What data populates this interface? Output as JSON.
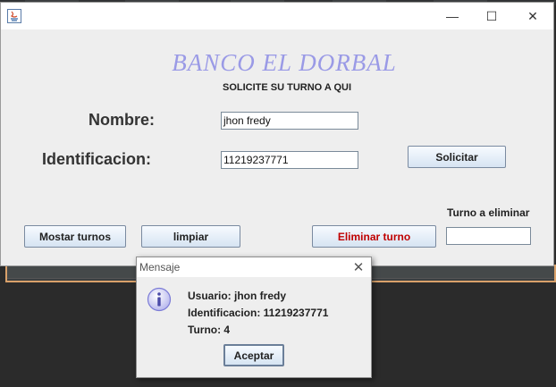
{
  "window": {
    "bank_title": "BANCO EL DORBAL",
    "subtitle": "SOLICITE SU TURNO  A QUI",
    "controls": {
      "minimize": "—",
      "maximize": "☐",
      "close": "✕"
    }
  },
  "form": {
    "nombre_label": "Nombre:",
    "nombre_value": "jhon fredy",
    "identificacion_label": "Identificacion:",
    "identificacion_value": "11219237771",
    "solicitar_button": "Solicitar",
    "turno_eliminar_label": "Turno a eliminar",
    "turno_eliminar_value": ""
  },
  "actions": {
    "mostrar_button": "Mostar turnos",
    "limpiar_button": "limpiar",
    "eliminar_button": "Eliminar turno"
  },
  "dialog": {
    "title": "Mensaje",
    "close": "✕",
    "lines": [
      "Usuario: jhon fredy",
      "Identificacion: 11219237771",
      "Turno: 4"
    ],
    "ok_button": "Aceptar"
  },
  "colors": {
    "title_accent": "#9a9ae6",
    "danger_text": "#c00000",
    "info_icon": "#7b7bd6"
  }
}
